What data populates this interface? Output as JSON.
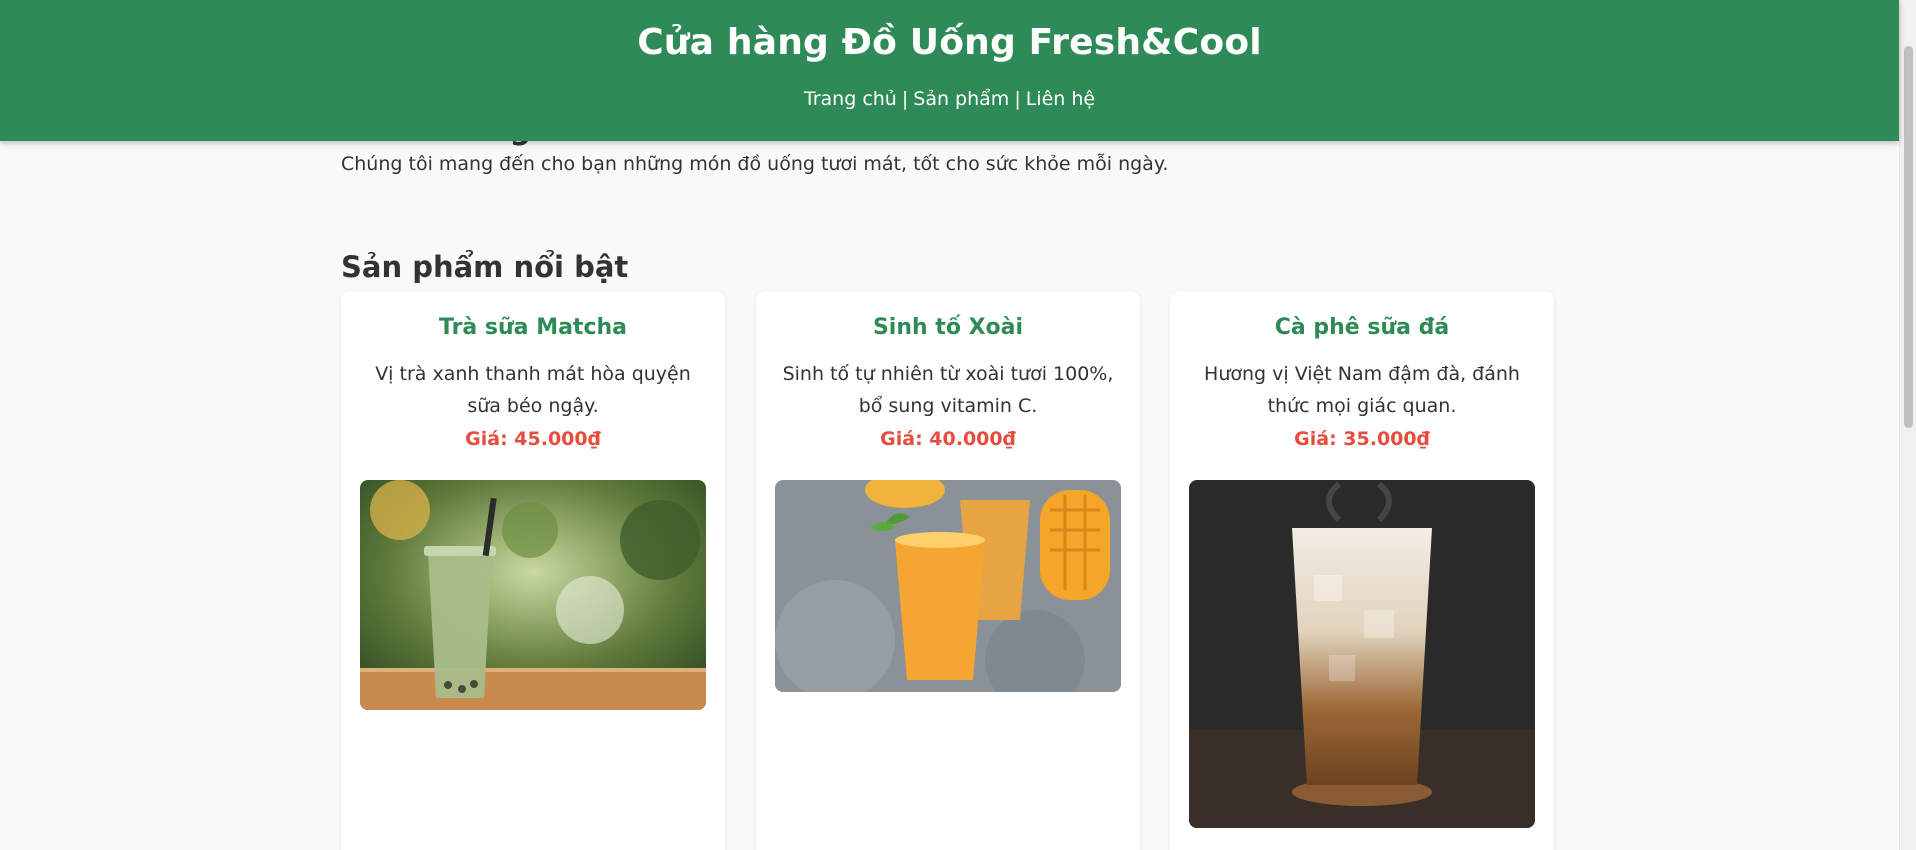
{
  "header": {
    "title": "Cửa hàng Đồ Uống Fresh&Cool",
    "nav": [
      {
        "label": "Trang chủ"
      },
      {
        "label": "Sản phẩm"
      },
      {
        "label": "Liên hệ"
      }
    ],
    "separator": "|"
  },
  "intro": {
    "heading": "Chào mừng",
    "text": "Chúng tôi mang đến cho bạn những món đồ uống tươi mát, tốt cho sức khỏe mỗi ngày."
  },
  "featured": {
    "title": "Sản phẩm nổi bật",
    "products": [
      {
        "name": "Trà sữa Matcha",
        "description": "Vị trà xanh thanh mát hòa quyện sữa béo ngậy.",
        "price": "Giá: 45.000₫"
      },
      {
        "name": "Sinh tố Xoài",
        "description": "Sinh tố tự nhiên từ xoài tươi 100%, bổ sung vitamin C.",
        "price": "Giá: 40.000₫"
      },
      {
        "name": "Cà phê sữa đá",
        "description": "Hương vị Việt Nam đậm đà, đánh thức mọi giác quan.",
        "price": "Giá: 35.000₫"
      }
    ]
  },
  "colors": {
    "brand_green": "#2e8b57",
    "price_red": "#e74c3c",
    "background": "#f9f9f9"
  }
}
